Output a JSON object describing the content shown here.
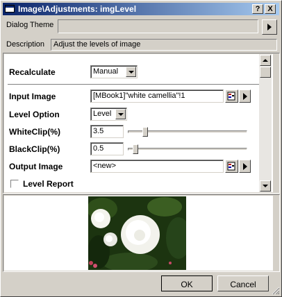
{
  "window": {
    "title": "Image\\Adjustments: imgLevel",
    "help_label": "?",
    "close_label": "X"
  },
  "theme": {
    "label": "Dialog Theme",
    "value": ""
  },
  "description": {
    "label": "Description",
    "text": "Adjust the levels of image"
  },
  "form": {
    "recalculate": {
      "label": "Recalculate",
      "value": "Manual"
    },
    "input_image": {
      "label": "Input Image",
      "value": "[MBook1]\"white camellia\"!1"
    },
    "level_option": {
      "label": "Level Option",
      "value": "Level"
    },
    "white_clip": {
      "label": "WhiteClip(%)",
      "value": "3.5",
      "level": 0.12
    },
    "black_clip": {
      "label": "BlackClip(%)",
      "value": "0.5",
      "level": 0.03
    },
    "output_image": {
      "label": "Output Image",
      "value": "<new>"
    },
    "level_report": {
      "label": "Level Report",
      "checked": false
    }
  },
  "buttons": {
    "ok": "OK",
    "cancel": "Cancel"
  },
  "icons": {
    "title": "window-icon",
    "theme_arrow": "right-arrow-icon",
    "picker": "browse-book-icon",
    "menu_arrow": "right-arrow-icon",
    "combo": "chevron-down-icon",
    "preview": "white-camellia-image"
  }
}
